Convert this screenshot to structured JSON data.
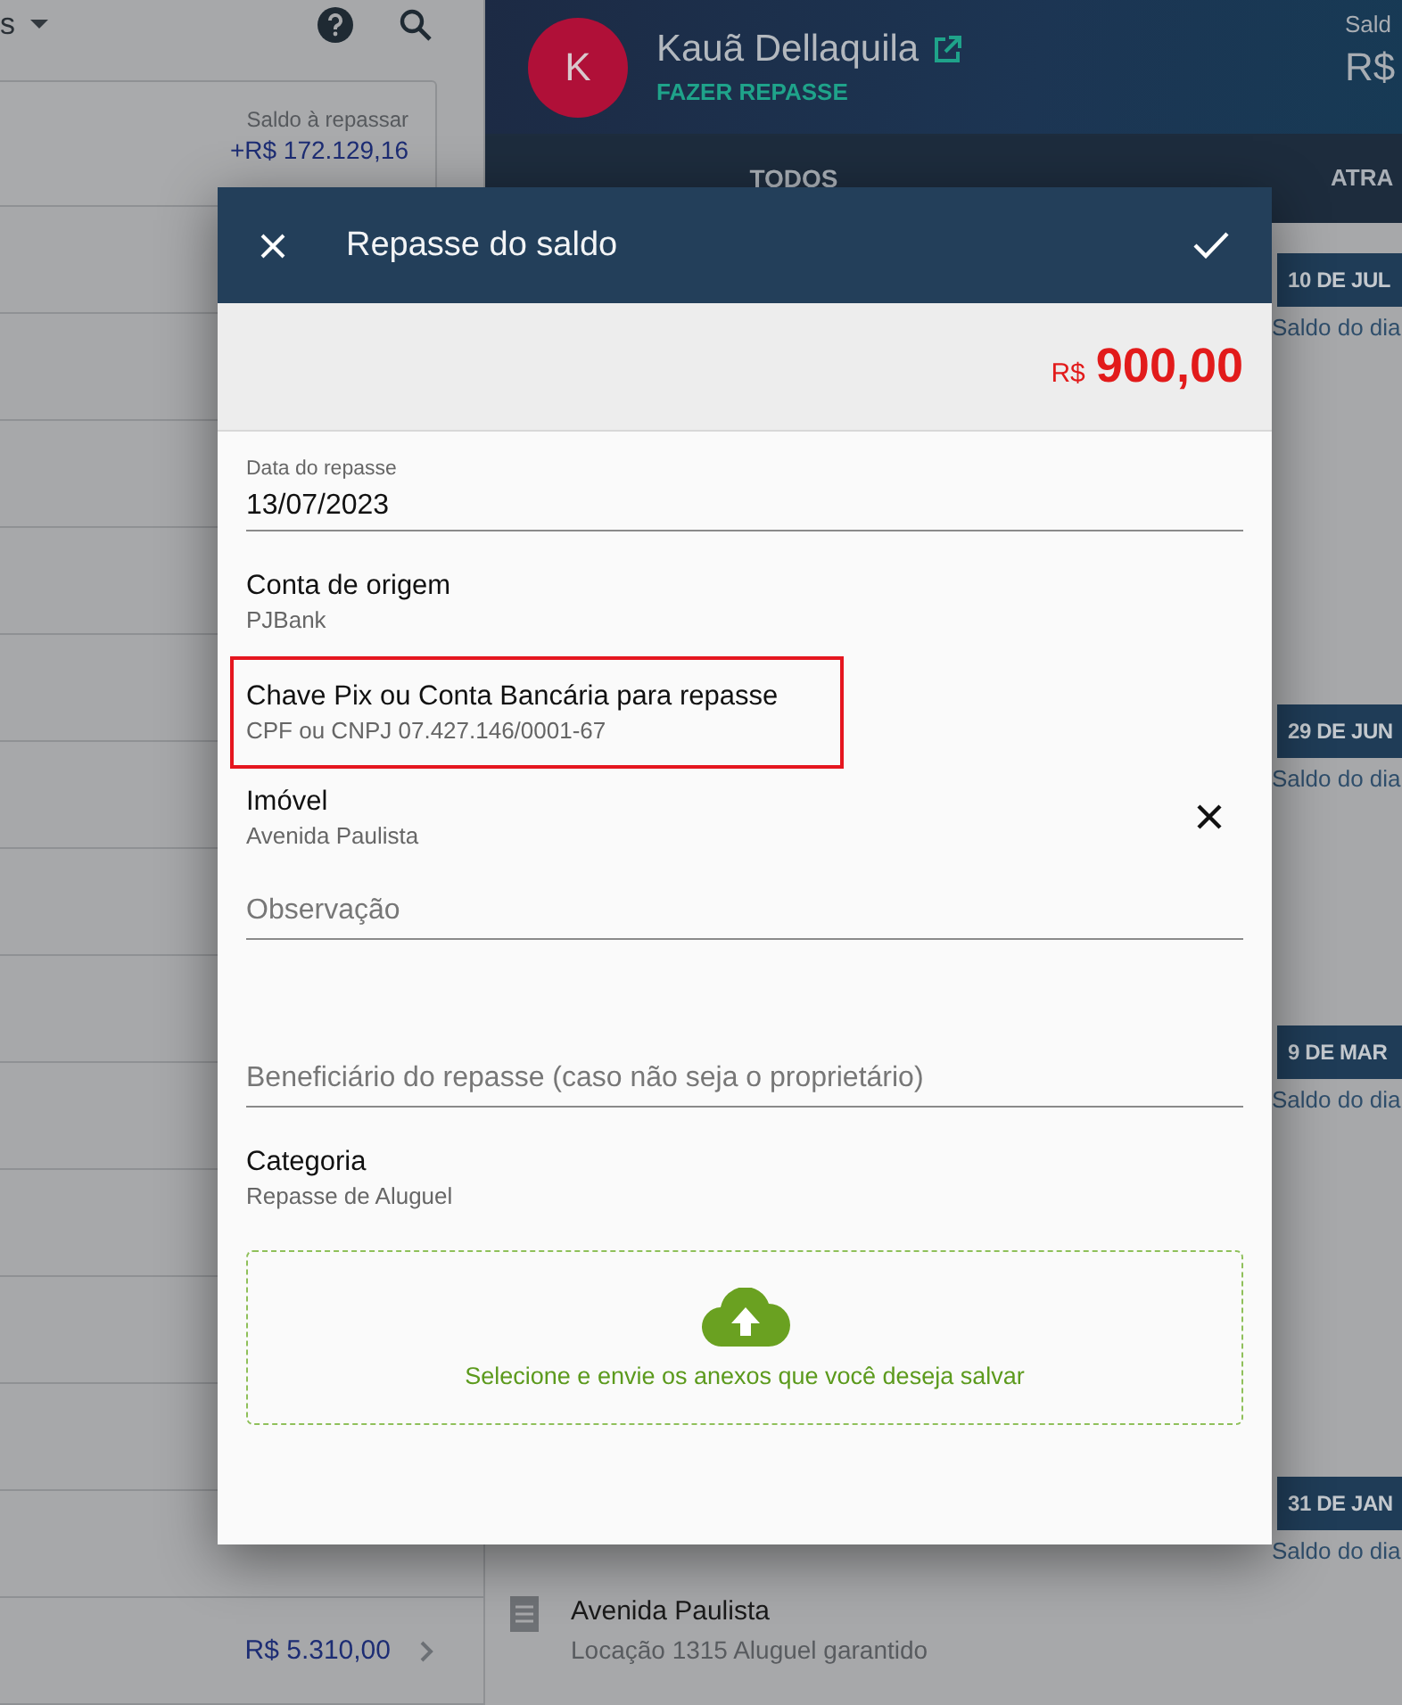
{
  "left_panel": {
    "dropdown_label": "s",
    "card": {
      "label": "Saldo à repassar",
      "value": "+R$ 172.129,16"
    },
    "last_row_amount": "R$ 5.310,00"
  },
  "profile": {
    "initial": "K",
    "name": "Kauã Dellaquila",
    "action": "FAZER REPASSE",
    "balance_label": "Sald",
    "balance_value": "R$"
  },
  "tabs": [
    {
      "label": "TODOS"
    },
    {
      "label": "ATRA"
    }
  ],
  "timeline": [
    {
      "date": "10 DE JUL",
      "note": "Saldo do dia"
    },
    {
      "date": "29 DE JUN",
      "note": "Saldo do dia"
    },
    {
      "date": "9 DE MAR",
      "note": "Saldo do dia"
    },
    {
      "date": "31 DE JAN",
      "note": "Saldo do dia"
    }
  ],
  "entry": {
    "title": "Avenida Paulista",
    "subtitle": "Locação 1315 Aluguel garantido"
  },
  "dialog": {
    "title": "Repasse do saldo",
    "amount": {
      "currency": "R$",
      "value": "900,00"
    },
    "fields": [
      {
        "kind": "input",
        "label": "Data do repasse",
        "value": "13/07/2023"
      },
      {
        "kind": "info",
        "label": "Conta de origem",
        "value": "PJBank",
        "highlighted": false,
        "clearable": false
      },
      {
        "kind": "info",
        "label": "Chave Pix ou Conta Bancária para repasse",
        "value": "CPF ou CNPJ 07.427.146/0001-67",
        "highlighted": true,
        "clearable": false
      },
      {
        "kind": "info",
        "label": "Imóvel",
        "value": "Avenida Paulista",
        "highlighted": false,
        "clearable": true
      },
      {
        "kind": "input",
        "placeholder": "Observação"
      },
      {
        "kind": "input",
        "placeholder": "Beneficiário do repasse (caso não seja o proprietário)"
      },
      {
        "kind": "info",
        "label": "Categoria",
        "value": "Repasse de Aluguel",
        "highlighted": false,
        "clearable": false
      }
    ],
    "upload": {
      "text": "Selecione e envie os anexos que você deseja salvar"
    }
  }
}
